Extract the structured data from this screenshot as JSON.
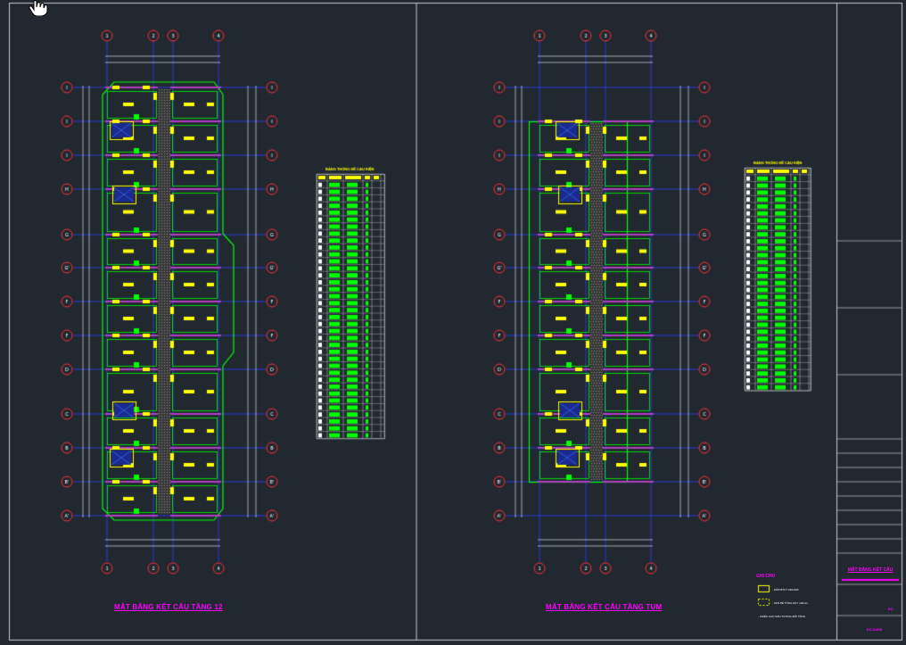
{
  "sheet": {
    "left_title": "MẶT BẰNG KẾT CẤU TẦNG 12",
    "right_title": "MẶT BẰNG KẾT CẤU TẦNG TUM",
    "titleblock_title": "MẶT BẰNG KẾT CẤU",
    "titleblock_code": "KC",
    "titleblock_drawing_no": "KC-04/05"
  },
  "legend": {
    "title": "GHI CHÚ",
    "items": [
      "- DẦM BTCT 220x400",
      "- SÀN BÊ TÔNG DÀY 120mm",
      "- CHIỀU CAO SÀN TƯƠNG ĐỐI TẦNG"
    ]
  },
  "tables": {
    "left_title": "BẢNG THỐNG KÊ CẤU KIỆN",
    "right_title": "BẢNG THỐNG KÊ CẤU KIỆN"
  },
  "grid": {
    "vertical": [
      "1",
      "2",
      "3",
      "4"
    ],
    "horizontal": [
      "I",
      "I",
      "I",
      "H",
      "G",
      "G'",
      "F",
      "F",
      "D",
      "C",
      "B",
      "B'",
      "A'"
    ]
  },
  "colors": {
    "background": "#212830",
    "grid_line": "#2f3cff",
    "wall": "#00ff00",
    "column": "#ffff00",
    "beam": "#b040c0",
    "text": "#ff00ff",
    "bubble": "#ff3030",
    "frame": "#c8c8c8"
  }
}
